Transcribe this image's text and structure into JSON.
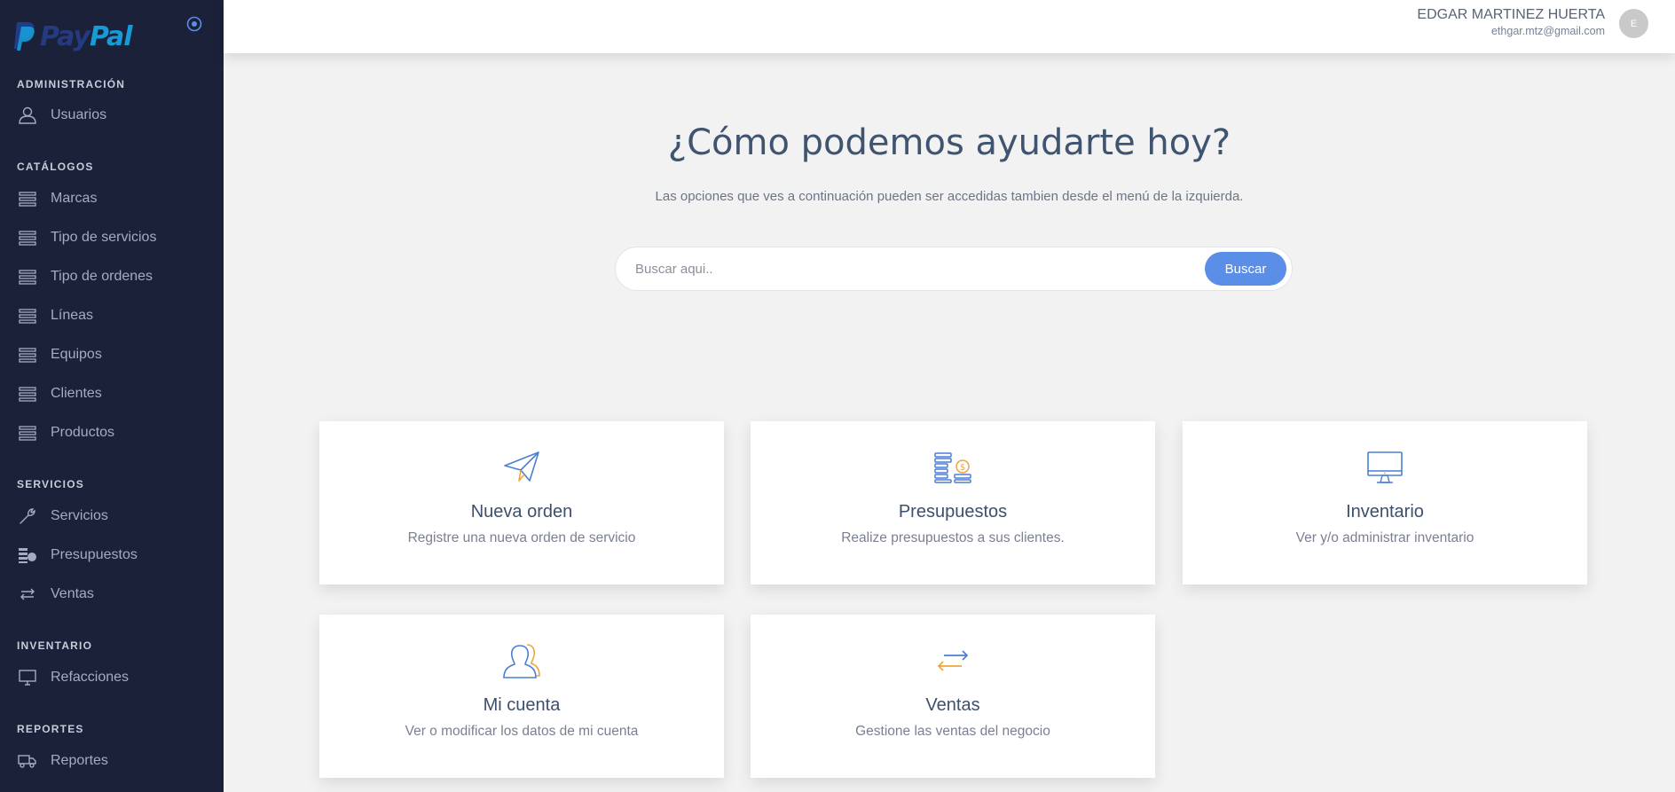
{
  "brand": {
    "logo_text_1": "Pay",
    "logo_text_2": "Pal"
  },
  "sidebar": {
    "sections": [
      {
        "label": "ADMINISTRACIÓN",
        "items": [
          {
            "label": "Usuarios",
            "icon": "user-icon"
          }
        ]
      },
      {
        "label": "CATÁLOGOS",
        "items": [
          {
            "label": "Marcas",
            "icon": "list-icon"
          },
          {
            "label": "Tipo de servicios",
            "icon": "list-icon"
          },
          {
            "label": "Tipo de ordenes",
            "icon": "list-icon"
          },
          {
            "label": "Líneas",
            "icon": "list-icon"
          },
          {
            "label": "Equipos",
            "icon": "list-icon"
          },
          {
            "label": "Clientes",
            "icon": "list-icon"
          },
          {
            "label": "Productos",
            "icon": "list-icon"
          }
        ]
      },
      {
        "label": "SERVICIOS",
        "items": [
          {
            "label": "Servicios",
            "icon": "wrench-icon"
          },
          {
            "label": "Presupuestos",
            "icon": "budget-icon"
          },
          {
            "label": "Ventas",
            "icon": "exchange-icon"
          }
        ]
      },
      {
        "label": "INVENTARIO",
        "items": [
          {
            "label": "Refacciones",
            "icon": "monitor-icon"
          }
        ]
      },
      {
        "label": "REPORTES",
        "items": [
          {
            "label": "Reportes",
            "icon": "truck-icon"
          }
        ]
      }
    ]
  },
  "header": {
    "user_name": "EDGAR MARTINEZ HUERTA",
    "user_email": "ethgar.mtz@gmail.com",
    "avatar_initial": "E"
  },
  "hero": {
    "title": "¿Cómo podemos ayudarte hoy?",
    "subtitle": "Las opciones que ves a continuación pueden ser accedidas tambien desde el menú de la izquierda.",
    "search_placeholder": "Buscar aqui..",
    "search_button": "Buscar"
  },
  "cards": [
    {
      "title": "Nueva orden",
      "desc": "Registre una nueva orden de servicio",
      "icon": "paper-plane-icon"
    },
    {
      "title": "Presupuestos",
      "desc": "Realize presupuestos a sus clientes.",
      "icon": "coins-stack-icon"
    },
    {
      "title": "Inventario",
      "desc": "Ver y/o administrar inventario",
      "icon": "monitor-icon"
    },
    {
      "title": "Mi cuenta",
      "desc": "Ver o modificar los datos de mi cuenta",
      "icon": "users-icon"
    },
    {
      "title": "Ventas",
      "desc": "Gestione las ventas del negocio",
      "icon": "exchange-icon"
    }
  ],
  "colors": {
    "sidebar_bg": "#1b2139",
    "accent": "#5b8ee6",
    "icon_blue": "#4a7fd4",
    "icon_orange": "#f0a43c"
  }
}
